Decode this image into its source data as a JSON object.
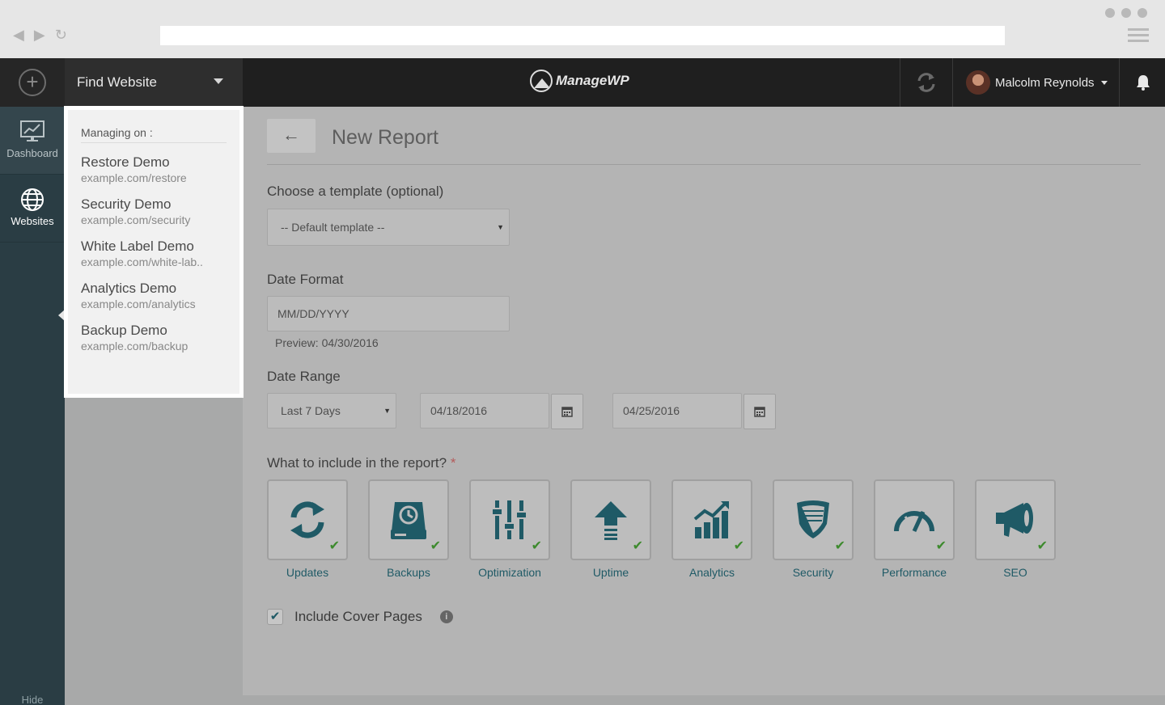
{
  "topbar": {
    "find_label": "Find Website",
    "logo": "ManageWP",
    "user_name": "Malcolm Reynolds"
  },
  "sidebar": {
    "items": [
      {
        "label": "Dashboard",
        "icon": "dashboard-icon"
      },
      {
        "label": "Websites",
        "icon": "globe-icon"
      }
    ],
    "hide_label": "Hide"
  },
  "dropdown": {
    "header": "Managing on :",
    "sites": [
      {
        "name": "Restore Demo",
        "url": "example.com/restore"
      },
      {
        "name": "Security Demo",
        "url": "example.com/security"
      },
      {
        "name": "White Label Demo",
        "url": "example.com/white-lab.."
      },
      {
        "name": "Analytics Demo",
        "url": "example.com/analytics"
      },
      {
        "name": "Backup Demo",
        "url": "example.com/backup"
      }
    ]
  },
  "report": {
    "back_icon": "arrow-left-icon",
    "title": "New Report",
    "template_label": "Choose a template (optional)",
    "template_value": "-- Default template --",
    "date_format_label": "Date Format",
    "date_format_value": "MM/DD/YYYY",
    "preview": "Preview: 04/30/2016",
    "date_range_label": "Date Range",
    "range_value": "Last 7 Days",
    "start_date": "04/18/2016",
    "end_date": "04/25/2016",
    "include_label": "What to include in the report?",
    "required_mark": "*",
    "sections": [
      {
        "label": "Updates",
        "icon": "refresh-icon",
        "checked": true
      },
      {
        "label": "Backups",
        "icon": "backup-drive-icon",
        "checked": true
      },
      {
        "label": "Optimization",
        "icon": "sliders-icon",
        "checked": true
      },
      {
        "label": "Uptime",
        "icon": "upload-arrow-icon",
        "checked": true
      },
      {
        "label": "Analytics",
        "icon": "bar-chart-icon",
        "checked": true
      },
      {
        "label": "Security",
        "icon": "shield-icon",
        "checked": true
      },
      {
        "label": "Performance",
        "icon": "speedometer-icon",
        "checked": true
      },
      {
        "label": "SEO",
        "icon": "megaphone-icon",
        "checked": true
      }
    ],
    "cover_label": "Include Cover Pages",
    "cover_checked": true
  },
  "colors": {
    "accent": "#1f5a66",
    "check": "#3d8a2d",
    "sidebar": "#2a3d44",
    "topbar": "#1f1f1f"
  }
}
